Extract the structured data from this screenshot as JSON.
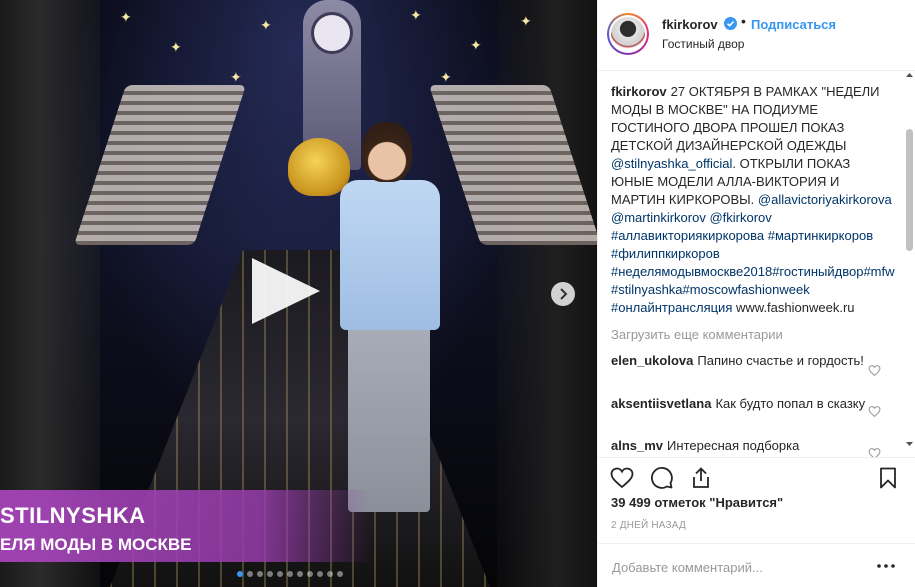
{
  "media": {
    "caption_line1": "STILNYSHKA",
    "caption_line2": "ЕЛЯ МОДЫ В МОСКВЕ",
    "carousel_dots": 11,
    "active_dot_index": 0
  },
  "header": {
    "username": "fkirkorov",
    "separator": "•",
    "follow_label": "Подписаться",
    "location": "Гостиный двор"
  },
  "caption": {
    "username": "fkirkorov",
    "text_part1": "27 ОКТЯБРЯ В РАМКАХ \"НЕДЕЛИ МОДЫ В МОСКВЕ\" НА ПОДИУМЕ ГОСТИНОГО ДВОРА ПРОШЕЛ ПОКАЗ ДЕТСКОЙ ДИЗАЙНЕРСКОЙ ОДЕЖДЫ",
    "mention_stilnyashka": "@stilnyashka_official",
    "text_part2": ". ОТКРЫЛИ ПОКАЗ ЮНЫЕ МОДЕЛИ АЛЛА-ВИКТОРИЯ И МАРТИН КИРКОРОВЫ.",
    "mention1": "@allavictoriyakirkorova",
    "mention2": "@martinkirkorov",
    "mention3": "@fkirkorov",
    "hashtag1": "#аллавикториякиркорова",
    "hashtag2": "#мартинкиркоров",
    "hashtag3": "#филиппкиркоров",
    "hashtag4": "#неделямодывмоскве2018",
    "hashtag5": "#гостиныйдвор",
    "hashtag6": "#mfw",
    "hashtag7": "#stilnyashka",
    "hashtag8": "#moscowfashionweek",
    "hashtag9": "#онлайнтрансляция",
    "website": "www.fashionweek.ru"
  },
  "load_more": "Загрузить еще комментарии",
  "comments": [
    {
      "username": "elen_ukolova",
      "text": "Папино счастье и гордость!"
    },
    {
      "username": "aksentiisvetlana",
      "text": "Как будто попал в сказку"
    },
    {
      "username": "alns_mv",
      "text": "Интересная подборка"
    }
  ],
  "likes": "39 499 отметок \"Нравится\"",
  "time_ago": "2 ДНЕЙ НАЗАД",
  "comment_input": {
    "placeholder": "Добавьте комментарий...",
    "value": ""
  },
  "colors": {
    "accent": "#3897f0",
    "link": "#003569",
    "muted": "#999999",
    "caption_bar": "#a646be"
  }
}
